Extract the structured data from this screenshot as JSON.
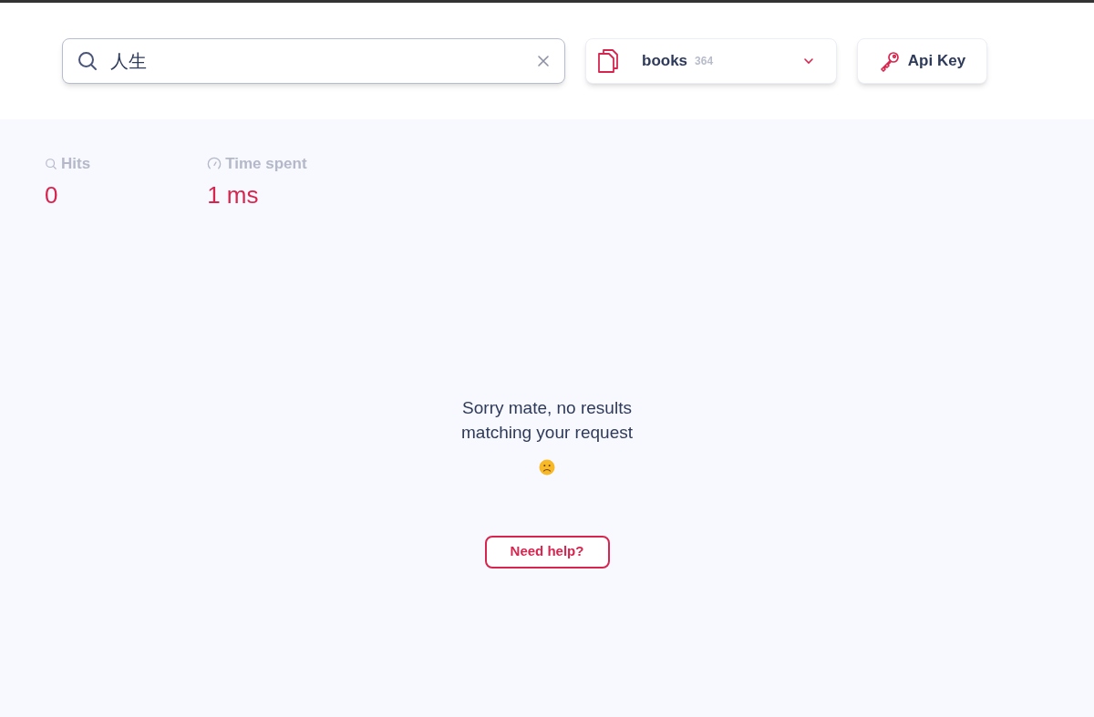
{
  "search": {
    "value": "人生"
  },
  "index_selector": {
    "name": "books",
    "count": "364"
  },
  "api_key_button": {
    "label": "Api Key"
  },
  "stats": [
    {
      "kind": "hits",
      "label": "Hits",
      "value": "0"
    },
    {
      "kind": "time",
      "label": "Time spent",
      "value": "1 ms"
    }
  ],
  "empty_state": {
    "message_lines": [
      "Sorry mate, no results",
      "matching your request"
    ]
  },
  "help_button": {
    "label": "Need help?"
  }
}
